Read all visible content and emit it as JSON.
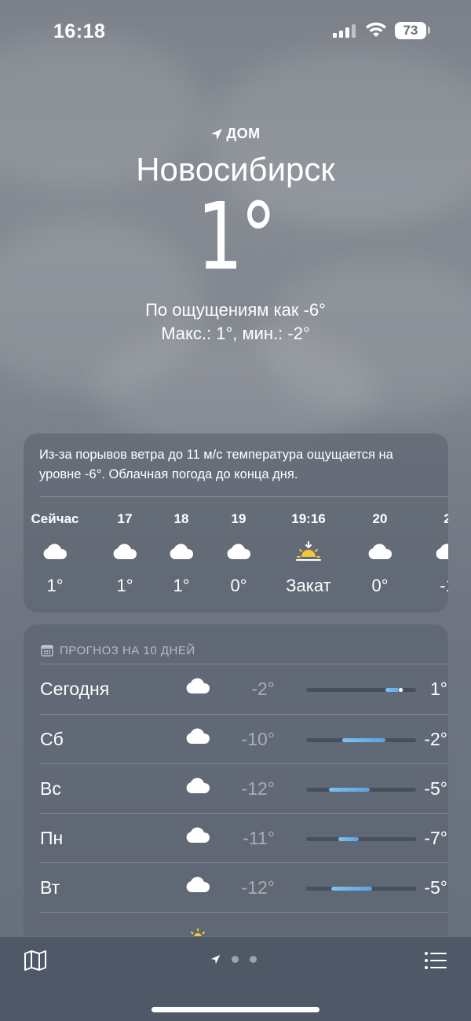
{
  "status_bar": {
    "time": "16:18",
    "battery": "73"
  },
  "location": {
    "label": "ДОМ",
    "city": "Новосибирск"
  },
  "current": {
    "temp": "1°",
    "feels_like": "По ощущениям как -6°",
    "minmax": "Макс.: 1°, мин.: -2°"
  },
  "hourly": {
    "summary": "Из-за порывов ветра до 11 м/с температура ощущается на уровне -6°. Облачная погода до конца дня.",
    "items": [
      {
        "label": "Сейчас",
        "icon": "cloud-icon",
        "temp": "1°"
      },
      {
        "label": "17",
        "icon": "cloud-icon",
        "temp": "1°"
      },
      {
        "label": "18",
        "icon": "cloud-icon",
        "temp": "1°"
      },
      {
        "label": "19",
        "icon": "cloud-icon",
        "temp": "0°"
      },
      {
        "label": "19:16",
        "icon": "sunset-icon",
        "temp": "Закат"
      },
      {
        "label": "20",
        "icon": "cloud-icon",
        "temp": "0°"
      },
      {
        "label": "2",
        "icon": "cloud-icon",
        "temp": "-1"
      }
    ]
  },
  "daily": {
    "header": "ПРОГНОЗ НА 10 ДНЕЙ",
    "days": [
      {
        "name": "Сегодня",
        "icon": "cloud-icon",
        "low": "-2°",
        "high": "1°",
        "bar_start": 0.72,
        "bar_end": 0.87,
        "current": 0.86
      },
      {
        "name": "Сб",
        "icon": "cloud-icon",
        "low": "-10°",
        "high": "-2°",
        "bar_start": 0.33,
        "bar_end": 0.72
      },
      {
        "name": "Вс",
        "icon": "cloud-icon",
        "low": "-12°",
        "high": "-5°",
        "bar_start": 0.21,
        "bar_end": 0.58
      },
      {
        "name": "Пн",
        "icon": "cloud-icon",
        "low": "-11°",
        "high": "-7°",
        "bar_start": 0.29,
        "bar_end": 0.48
      },
      {
        "name": "Вт",
        "icon": "cloud-icon",
        "low": "-12°",
        "high": "-5°",
        "bar_start": 0.23,
        "bar_end": 0.6
      }
    ]
  },
  "colors": {
    "bar_fill_start": "#7fc2ef",
    "bar_fill_end": "#5aa1e6",
    "sun": "#f3c53a"
  }
}
